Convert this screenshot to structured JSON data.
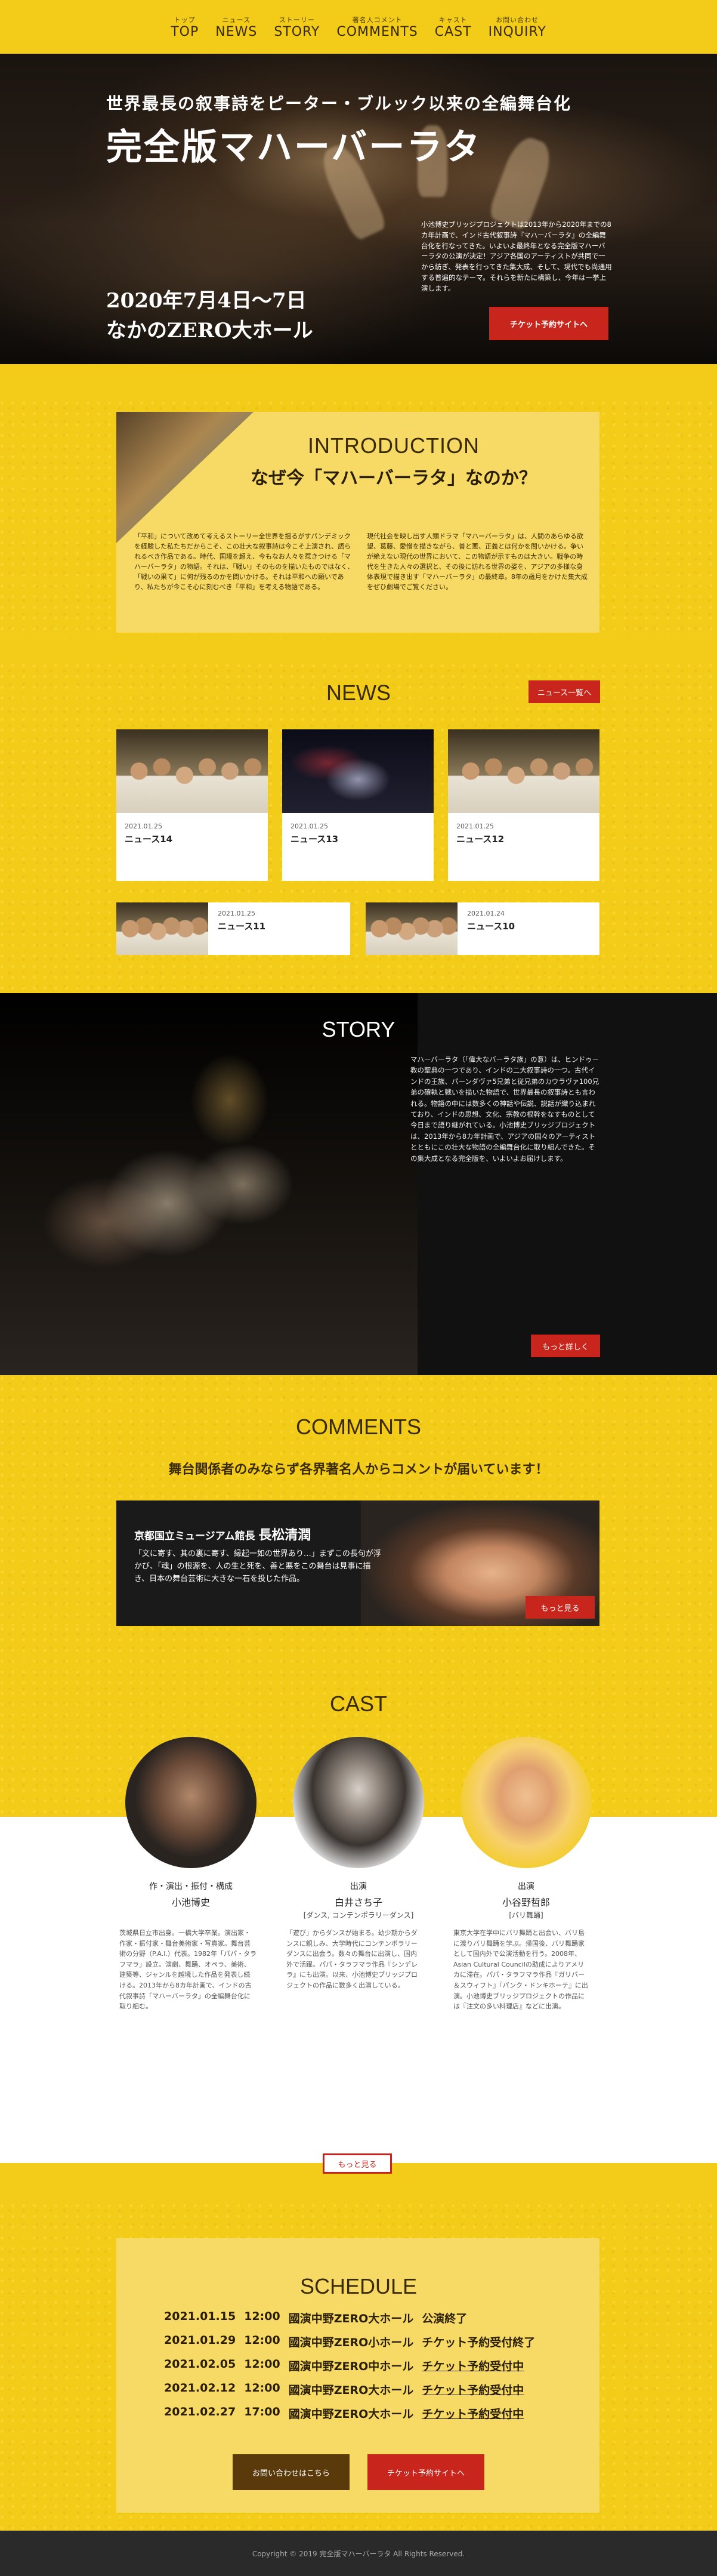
{
  "nav": [
    {
      "jp": "トップ",
      "en": "TOP"
    },
    {
      "jp": "ニュース",
      "en": "NEWS"
    },
    {
      "jp": "ストーリー",
      "en": "STORY"
    },
    {
      "jp": "著名人コメント",
      "en": "COMMENTS"
    },
    {
      "jp": "キャスト",
      "en": "CAST"
    },
    {
      "jp": "お問い合わせ",
      "en": "INQUIRY"
    }
  ],
  "hero": {
    "subtitle": "世界最長の叙事詩をピーター・ブルック以来の全編舞台化",
    "title": "完全版マハーバーラタ",
    "date": "2020年7月4日〜7日",
    "venue": "なかのZERO大ホール",
    "text": "小池博史ブリッジプロジェクトは2013年から2020年までの8カ年計画で、インド古代叙事詩『マハーバーラタ』の全編舞台化を行なってきた。いよいよ最終年となる完全版マハーバーラタの公演が決定！アジア各国のアーティストが共同で一から紡ぎ、発表を行ってきた集大成、そして、現代でも尚通用する普遍的なテーマ。それらを新たに構築し、今年は一挙上演します。",
    "ticket": "チケット予約サイトへ"
  },
  "intro": {
    "en": "INTRODUCTION",
    "jp": "なぜ今「マハーバーラタ」なのか？",
    "left": "「平和」について改めて考えるストーリー全世界を揺るがすパンデミックを経験した私たちだからこそ、この壮大な叙事詩は今こそ上演され、語られるべき作品である。時代、国境を超え、今もなお人々を惹きつける「マハーバーラタ」の物語。それは、「戦い」そのものを描いたものではなく、「戦いの果て」に何が残るのかを問いかける。それは平和への願いであり、私たちが今こそ心に刻むべき「平和」を考える物語である。",
    "right": "現代社会を映し出す人類ドラマ「マハーバーラタ」は、人間のあらゆる欲望、葛藤、愛憎を描きながら、善と悪、正義とは何かを問いかける。争いが絶えない現代の世界において、この物語が示すものは大きい。戦争の時代を生きた人々の選択と、その後に訪れる世界の姿を、アジアの多様な身体表現で描き出す「マハーバーラタ」の最終章。8年の歳月をかけた集大成をぜひ劇場でご覧ください。"
  },
  "news": {
    "title": "NEWS",
    "list_btn": "ニュース一覧へ",
    "items": [
      {
        "date": "2021.01.25",
        "title": "ニュース14"
      },
      {
        "date": "2021.01.25",
        "title": "ニュース13"
      },
      {
        "date": "2021.01.25",
        "title": "ニュース12"
      },
      {
        "date": "2021.01.25",
        "title": "ニュース11"
      },
      {
        "date": "2021.01.24",
        "title": "ニュース10"
      }
    ]
  },
  "story": {
    "title": "STORY",
    "text": "マハーバーラタ（「偉大なバーラタ族」の意）は、ヒンドゥー教の聖典の一つであり、インドの二大叙事詩の一つ。古代インドの王族、パーンダヴァ5兄弟と従兄弟のカウラヴァ100兄弟の確執と戦いを描いた物語で、世界最長の叙事詩とも言われる。物語の中には数多くの神話や伝説、説話が織り込まれており、インドの思想、文化、宗教の根幹をなすものとして今日まで語り継がれている。小池博史ブリッジプロジェクトは、2013年から8カ年計画で、アジアの国々のアーティストとともにこの壮大な物語の全編舞台化に取り組んできた。その集大成となる完全版を、いよいよお届けします。",
    "more": "もっと詳しく"
  },
  "comments": {
    "title": "COMMENTS",
    "lead": "舞台関係者のみならず各界著名人からコメントが届いています！",
    "org": "京都国立ミュージアム館長",
    "name": "長松清潤",
    "text": "「文に寄す、其の裏に寄す、縁起一如の世界あり…」まずこの長句が浮かび、「魂」の根源を、人の生と死を、善と悪をこの舞台は見事に描き、日本の舞台芸術に大きな一石を投じた作品。",
    "more": "もっと見る"
  },
  "cast": {
    "title": "CAST",
    "more": "もっと見る",
    "members": [
      {
        "role": "作・演出・振付・構成",
        "name": "小池博史",
        "note": "",
        "bio": "茨城県日立市出身。一橋大学卒業。演出家・作家・振付家・舞台美術家・写真家。舞台芸術の分野（P.A.I.）代表。1982年「パパ・タラフマラ」設立。演劇、舞踊、オペラ、美術、建築等、ジャンルを越境した作品を発表し続ける。2013年から8カ年計画で、インドの古代叙事詩「マハーバーラタ」の全編舞台化に取り組む。"
      },
      {
        "role": "出演",
        "name": "白井さち子",
        "note": "[ダンス, コンテンポラリーダンス]",
        "bio": "「遊び」からダンスが始まる。幼少期からダンスに親しみ、大学時代にコンテンポラリーダンスに出会う。数々の舞台に出演し、国内外で活躍。パパ・タラフマラ作品『シンデレラ』にも出演。以来、小池博史ブリッジプロジェクトの作品に数多く出演している。"
      },
      {
        "role": "出演",
        "name": "小谷野哲郎",
        "note": "[バリ舞踊]",
        "bio": "東京大学在学中にバリ舞踊と出会い、バリ島に渡りバリ舞踊を学ぶ。帰国後、バリ舞踊家として国内外で公演活動を行う。2008年、Asian Cultural Councilの助成によりアメリカに滞在。パパ・タラフマラ作品『ガリバー＆スウィフト』『パンク・ドンキホーテ』に出演。小池博史ブリッジプロジェクトの作品には『注文の多い料理店』などに出演。"
      }
    ]
  },
  "schedule": {
    "title": "SCHEDULE",
    "rows": [
      {
        "date": "2021.01.15",
        "time": "12:00",
        "venue": "國演中野ZERO大ホール",
        "status": "公演終了",
        "link": false
      },
      {
        "date": "2021.01.29",
        "time": "12:00",
        "venue": "國演中野ZERO小ホール",
        "status": "チケット予約受付終了",
        "link": false
      },
      {
        "date": "2021.02.05",
        "time": "12:00",
        "venue": "國演中野ZERO中ホール",
        "status": "チケット予約受付中",
        "link": true
      },
      {
        "date": "2021.02.12",
        "time": "12:00",
        "venue": "國演中野ZERO大ホール",
        "status": "チケット予約受付中",
        "link": true
      },
      {
        "date": "2021.02.27",
        "time": "17:00",
        "venue": "國演中野ZERO大ホール",
        "status": "チケット予約受付中",
        "link": true
      }
    ],
    "contact": "お問い合わせはこちら",
    "ticket": "チケット予約サイトへ"
  },
  "footer": "Copyright © 2019 完全版マハーバーラタ All Rights Reserved.",
  "colors": {
    "yellow": "#f3cc1a",
    "red": "#c8261c",
    "brown": "#5a3a0a"
  }
}
